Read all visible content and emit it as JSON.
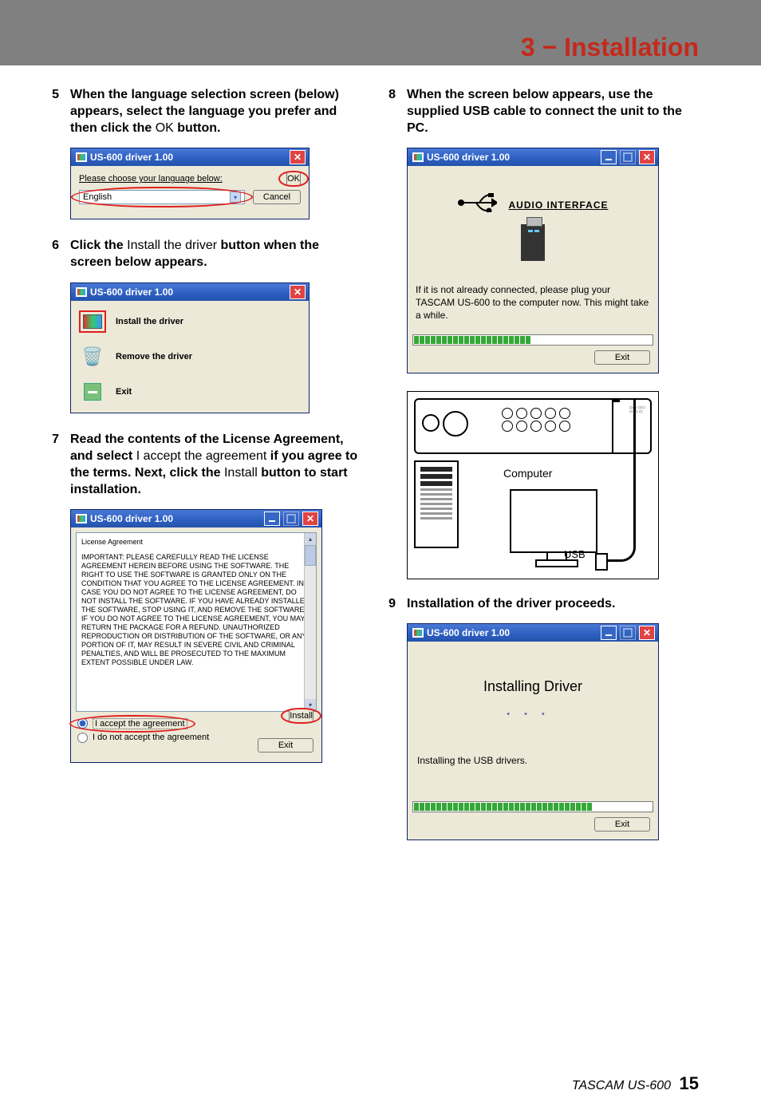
{
  "header": {
    "title": "3 − Installation"
  },
  "footer": {
    "product": "TASCAM US-600",
    "page": "15"
  },
  "steps": {
    "s5": {
      "num": "5",
      "t1": "When the language selection screen (below) appears, select the language you prefer and then click the ",
      "t1_roman": "OK",
      "t1_end": " button."
    },
    "s6": {
      "num": "6",
      "t1": "Click the ",
      "t1_roman": "Install the driver",
      "t1_end": " button when the screen below appears."
    },
    "s7": {
      "num": "7",
      "t1": "Read the contents of the License Agreement, and select ",
      "t1_roman": "I accept the agreement",
      "t2": " if you agree to the terms. Next, click the ",
      "t2_roman": "Install",
      "t2_end": " button to start installation."
    },
    "s8": {
      "num": "8",
      "t1": "When the screen below appears, use the supplied USB cable to connect the unit to the PC."
    },
    "s9": {
      "num": "9",
      "t1": "Installation of the driver proceeds."
    }
  },
  "win5": {
    "title": "US-600 driver 1.00",
    "label": "Please choose your language below:",
    "lang": "English",
    "ok": "OK",
    "cancel": "Cancel"
  },
  "win6": {
    "title": "US-600 driver 1.00",
    "opt_install": "Install the driver",
    "opt_remove": "Remove the driver",
    "opt_exit": "Exit"
  },
  "win7": {
    "title": "US-600 driver 1.00",
    "lic_title": "License Agreement",
    "lic_body": "IMPORTANT:  PLEASE CAREFULLY READ THE LICENSE AGREEMENT HEREIN BEFORE USING THE SOFTWARE. THE RIGHT TO USE THE SOFTWARE IS GRANTED ONLY ON THE CONDITION THAT YOU AGREE TO THE LICENSE AGREEMENT.  IN CASE YOU DO NOT AGREE TO THE LICENSE AGREEMENT, DO NOT INSTALL THE SOFTWARE. IF YOU HAVE ALREADY INSTALLED THE SOFTWARE, STOP USING IT, AND REMOVE THE SOFTWARE.  IF YOU DO NOT AGREE TO THE LICENSE AGREEMENT, YOU MAY RETURN THE PACKAGE FOR A REFUND.  UNAUTHORIZED REPRODUCTION OR DISTRIBUTION OF THE SOFTWARE, OR ANY PORTION OF IT, MAY RESULT IN SEVERE CIVIL AND CRIMINAL PENALTIES, AND WILL BE PROSECUTED TO THE MAXIMUM EXTENT POSSIBLE UNDER LAW.",
    "accept": "I accept the agreement",
    "reject": "I do not accept the agreement",
    "install": "Install",
    "exit": "Exit"
  },
  "win8": {
    "title": "US-600 driver 1.00",
    "iface": "AUDIO INTERFACE",
    "msg": "If it is not already connected, please plug your TASCAM US-600 to the computer now.  This might take a while.",
    "exit": "Exit",
    "progress_segments": 21
  },
  "diagram": {
    "computer": "Computer",
    "usb": "USB"
  },
  "win9": {
    "title": "US-600 driver 1.00",
    "big": "Installing Driver",
    "msg": "Installing the USB drivers.",
    "exit": "Exit",
    "progress_segments": 32
  }
}
